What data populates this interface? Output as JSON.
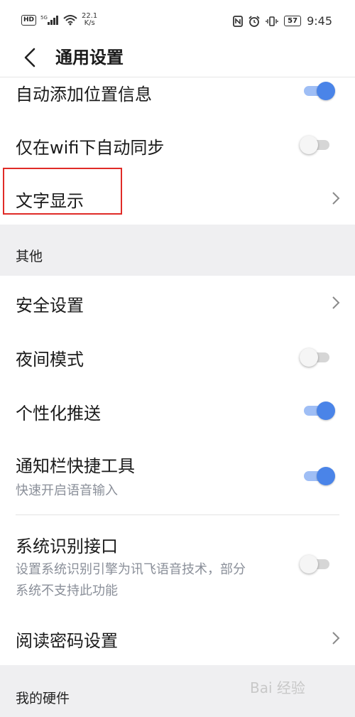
{
  "status_bar": {
    "network_badge": "HD",
    "signal_label": "5G",
    "speed_value": "22.1",
    "speed_unit": "K/s",
    "battery": "57",
    "time": "9:45"
  },
  "header": {
    "title": "通用设置",
    "back_icon": "back-arrow-icon"
  },
  "rows": {
    "location": {
      "label": "自动添加位置信息",
      "toggle": true
    },
    "wifi_sync": {
      "label": "仅在wifi下自动同步",
      "toggle": false
    },
    "text_display": {
      "label": "文字显示"
    },
    "security": {
      "label": "安全设置"
    },
    "night_mode": {
      "label": "夜间模式",
      "toggle": false
    },
    "push": {
      "label": "个性化推送",
      "toggle": true
    },
    "notif_tools": {
      "label": "通知栏快捷工具",
      "sub": "快速开启语音输入",
      "toggle": true
    },
    "system_iface": {
      "label": "系统识别接口",
      "sub": "设置系统识别引擎为讯飞语音技术，部分系统不支持此功能",
      "toggle": false
    },
    "read_password": {
      "label": "阅读密码设置"
    }
  },
  "sections": {
    "other": "其他",
    "my_hardware": "我的硬件"
  },
  "colors": {
    "accent": "#4a84e8",
    "highlight_border": "#e02b27",
    "section_bg": "#efeff1"
  },
  "watermark": "Bai 经验"
}
